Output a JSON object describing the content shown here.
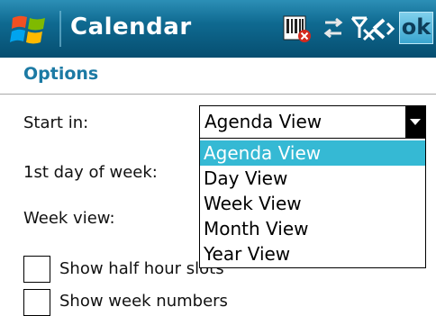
{
  "titlebar": {
    "app_title": "Calendar",
    "ok_label": "ok",
    "icons": [
      "windows-start-icon",
      "sim-card-error-icon",
      "sync-arrows-icon",
      "signal-off-icon",
      "volume-icon"
    ]
  },
  "options": {
    "header": "Options",
    "start_in_label": "Start in:",
    "first_day_label": "1st day of week:",
    "week_view_label": "Week view:",
    "start_in_value": "Agenda View",
    "start_in_options": [
      "Agenda View",
      "Day View",
      "Week View",
      "Month View",
      "Year View"
    ],
    "selected_index": 0,
    "half_hour_label": "Show half hour slots",
    "week_numbers_label": "Show week numbers",
    "half_hour_checked": false,
    "week_numbers_checked": false
  },
  "colors": {
    "accent": "#1c7aa4",
    "selection": "#35b9d4",
    "titlebar_dark": "#064e70"
  }
}
